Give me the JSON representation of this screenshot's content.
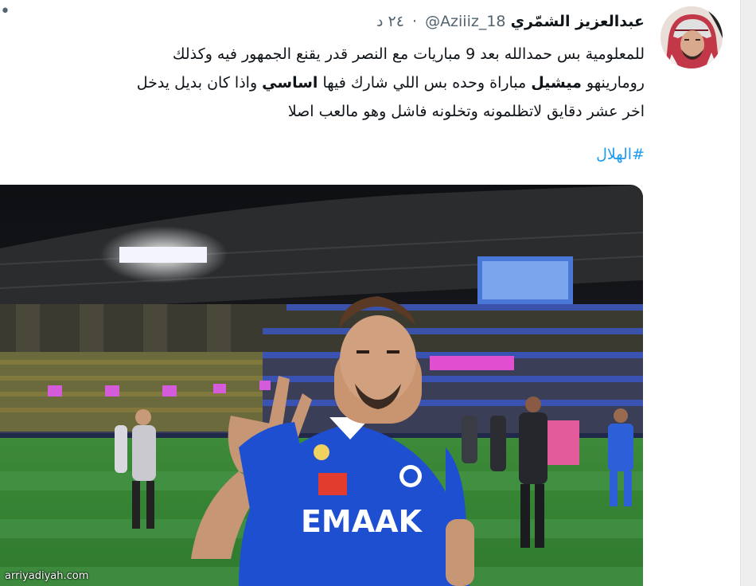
{
  "tweet": {
    "author_name": "عبدالعزيز الشمّري",
    "handle": "@Aziiiz_18",
    "separator": "·",
    "time": "٢٤ د",
    "more_label": "•",
    "body_lines": [
      "للمعلومية بس حمدالله بعد 9 مباريات مع النصر قدر يقنع الجمهور فيه وكذلك",
      {
        "parts": [
          "رومارينهو ",
          "ميشيل",
          " مباراة وحده بس اللي شارك فيها ",
          "اساسي",
          " واذا كان بديل يدخل"
        ]
      },
      "اخر عشر دقايق لاتظلمونه وتخلونه فاشل وهو مالعب اصلا"
    ],
    "hashtag": "#الهلال"
  },
  "media": {
    "jersey_sponsor": "EMAAK",
    "watermark": "arriyadiyah.com"
  },
  "colors": {
    "hashtag": "#1d9bf0",
    "secondary_text": "#536471",
    "jersey_blue": "#1f4fd1"
  }
}
